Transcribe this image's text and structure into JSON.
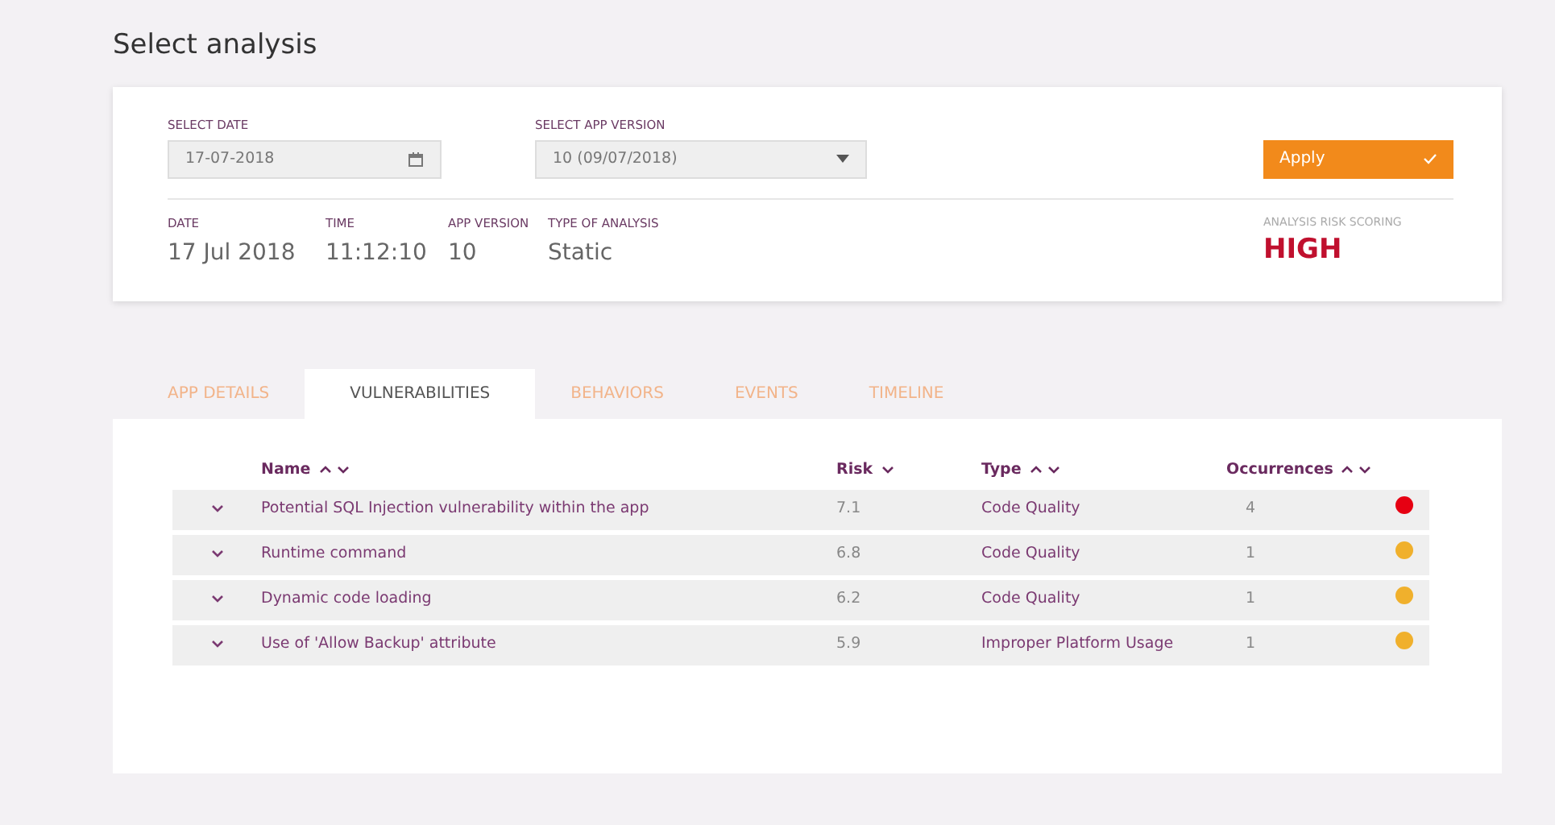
{
  "page_title": "Select analysis",
  "filters": {
    "date": {
      "label": "SELECT DATE",
      "value": "17-07-2018"
    },
    "version": {
      "label": "SELECT APP VERSION",
      "value": "10 (09/07/2018)"
    },
    "apply": "Apply"
  },
  "summary": [
    {
      "label": "DATE",
      "value": "17 Jul 2018"
    },
    {
      "label": "TIME",
      "value": "11:12:10"
    },
    {
      "label": "APP VERSION",
      "value": "10"
    },
    {
      "label": "TYPE OF ANALYSIS",
      "value": "Static"
    }
  ],
  "risk": {
    "label": "ANALYSIS RISK SCORING",
    "value": "HIGH",
    "color": "#c0102e"
  },
  "tabs": [
    {
      "label": "APP DETAILS",
      "selected": false
    },
    {
      "label": "VULNERABILITIES",
      "selected": true
    },
    {
      "label": "BEHAVIORS",
      "selected": false
    },
    {
      "label": "EVENTS",
      "selected": false
    },
    {
      "label": "TIMELINE",
      "selected": false
    }
  ],
  "table": {
    "columns": [
      {
        "label": "Name",
        "kind": "both"
      },
      {
        "label": "Risk",
        "kind": "down"
      },
      {
        "label": "Type",
        "kind": "both"
      },
      {
        "label": "Occurrences",
        "kind": "both"
      }
    ],
    "rows": [
      {
        "name": "Potential SQL Injection vulnerability within the app",
        "risk": "7.1",
        "type": "Code Quality",
        "occurrences": "4",
        "color": "#e60012"
      },
      {
        "name": "Runtime command",
        "risk": "6.8",
        "type": "Code Quality",
        "occurrences": "1",
        "color": "#f0b02c"
      },
      {
        "name": "Dynamic code loading",
        "risk": "6.2",
        "type": "Code Quality",
        "occurrences": "1",
        "color": "#f0b02c"
      },
      {
        "name": "Use of 'Allow Backup' attribute",
        "risk": "5.9",
        "type": "Improper Platform Usage",
        "occurrences": "1",
        "color": "#f0b02c"
      }
    ]
  }
}
